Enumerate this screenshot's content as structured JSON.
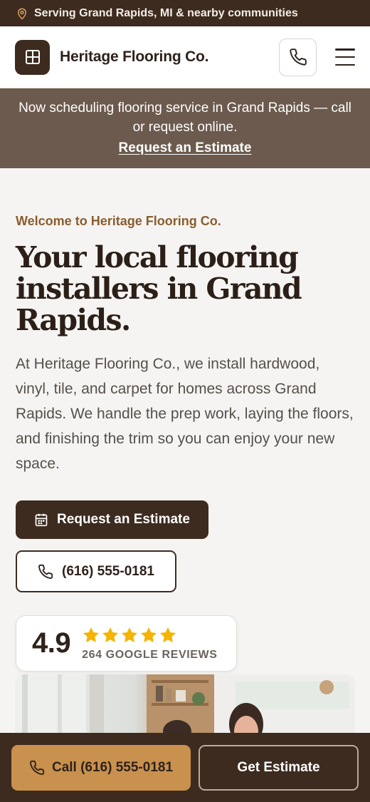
{
  "topbar": {
    "text": "Serving Grand Rapids, MI & nearby communities",
    "icon": "map-pin-icon"
  },
  "header": {
    "brand": "Heritage Flooring Co.",
    "logo_icon": "grid-icon",
    "phone_icon": "phone-icon",
    "menu_icon": "menu-icon"
  },
  "notice": {
    "message": "Now scheduling flooring service in Grand Rapids — call or request online.",
    "link": "Request an Estimate"
  },
  "hero": {
    "eyebrow": "Welcome to Heritage Flooring Co.",
    "headline": "Your local flooring installers in Grand Rapids.",
    "lead": "At Heritage Flooring Co., we install hardwood, vinyl, tile, and carpet for homes across Grand Rapids. We handle the prep work, laying the floors, and finishing the trim so you can enjoy your new space.",
    "primary_button": "Request an Estimate",
    "phone_button": "(616) 555-0181"
  },
  "rating": {
    "score": "4.9",
    "stars": 5,
    "reviews": "264 GOOGLE REVIEWS"
  },
  "bottom_bar": {
    "call": "Call (616) 555-0181",
    "estimate": "Get Estimate"
  },
  "colors": {
    "brand_dark": "#3d2b20",
    "accent_gold": "#c9914e",
    "eyebrow": "#8a5d2e",
    "star": "#f4b400",
    "notice_bg": "#6b5a4d"
  }
}
